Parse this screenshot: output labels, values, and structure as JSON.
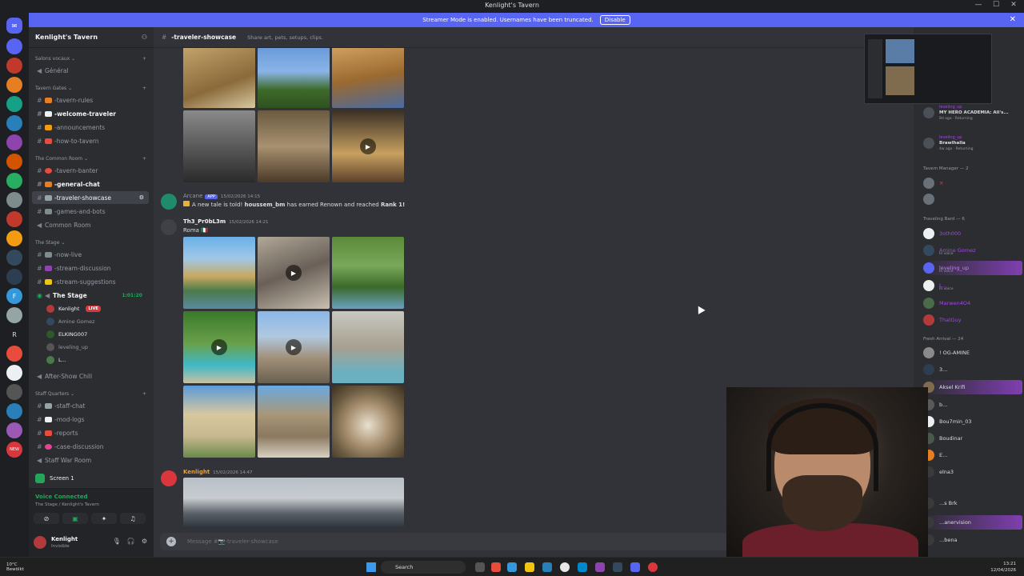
{
  "window": {
    "title": "Kenlight's Tavern"
  },
  "banner": {
    "text": "Streamer Mode is enabled. Usernames have been truncated.",
    "action": "Disable"
  },
  "guild": {
    "name": "Kenlight's Tavern"
  },
  "categories": {
    "voice": "Salons vocaux",
    "gates": "Tavern Gates",
    "common": "The Common Room",
    "stage": "The Stage",
    "staff": "Staff Quarters"
  },
  "channels": {
    "general": "Général",
    "tavern_rules": "-tavern-rules",
    "welcome": "-welcome-traveler",
    "announcements": "-announcements",
    "how_to": "-how-to-tavern",
    "banter": "-tavern-banter",
    "general_chat": "-general-chat",
    "showcase": "-traveler-showcase",
    "games": "-games-and-bots",
    "common_room": "Common Room",
    "now_live": "-now-live",
    "stream_discussion": "-stream-discussion",
    "stream_suggestions": "-stream-suggestions",
    "the_stage": "The Stage",
    "after_show": "After-Show Chill",
    "staff_chat": "-staff-chat",
    "mod_logs": "-mod-logs",
    "reports": "-reports",
    "case_discussion": "-case-discussion",
    "war_room": "Staff War Room"
  },
  "stage_voice": {
    "timer": "1:01:20",
    "users": [
      "Kenlight",
      "Amine Gomez",
      "ELKING007",
      "leveling_up",
      "L..."
    ],
    "live": "LIVE"
  },
  "screen": {
    "label": "Screen 1"
  },
  "voice_panel": {
    "status": "Voice Connected",
    "location": "The Stage / Kenlight's Tavern"
  },
  "user_panel": {
    "name": "Kenlight",
    "status": "Invisible"
  },
  "header": {
    "channel": "-traveler-showcase",
    "topic": "Share art, pets, setups, clips."
  },
  "messages": {
    "m1": {
      "author": "Arcane",
      "tag": "APP",
      "time": "15/02/2026 14:15",
      "text_prefix": "A new tale is told! ",
      "user": "houssem_bm",
      "text_mid": " has earned Renown and reached ",
      "rank": "Rank 1!"
    },
    "m2": {
      "author": "Th3_Pr0bL3m",
      "time": "15/02/2026 14:21",
      "text": "Roma 🇮🇹"
    },
    "m3": {
      "author": "Kenlight",
      "time": "15/02/2026 14:47"
    }
  },
  "composer": {
    "placeholder": "Message #📷-traveler-showcase"
  },
  "members": {
    "top": [
      {
        "name": "leveling_up",
        "sub": "MY HERO ACADEMIA: All's...",
        "sub2": "8d ago · Returning"
      },
      {
        "name": "leveling_up",
        "sub": "Brawlhalla",
        "sub2": "4w ago · Returning"
      }
    ],
    "cat_manager": "Tavern Manager — 2",
    "cat_bard": "Traveling Bard — 6",
    "bards": [
      "3oth000",
      "Amine Gomez",
      "leveling_up",
      "L...",
      "Marwen4O4",
      "ThatGuy"
    ],
    "in_voice": "In voice",
    "cat_fresh": "Fresh Arrival — 24",
    "fresh": [
      "! OG-AMINE",
      "3...",
      "Aksel Krifi",
      "b...",
      "Bou7min_03",
      "Boudinar",
      "E...",
      "elna3",
      "...s Brk",
      "...anervision",
      "...bena"
    ]
  },
  "taskbar": {
    "weather_temp": "10°C",
    "weather_desc": "Bewölkt",
    "search": "Search",
    "time": "13:21",
    "date": "12/04/2026"
  },
  "colors": {
    "blurple": "#5865f2",
    "live": "#da373c",
    "voice": "#23a55a"
  }
}
